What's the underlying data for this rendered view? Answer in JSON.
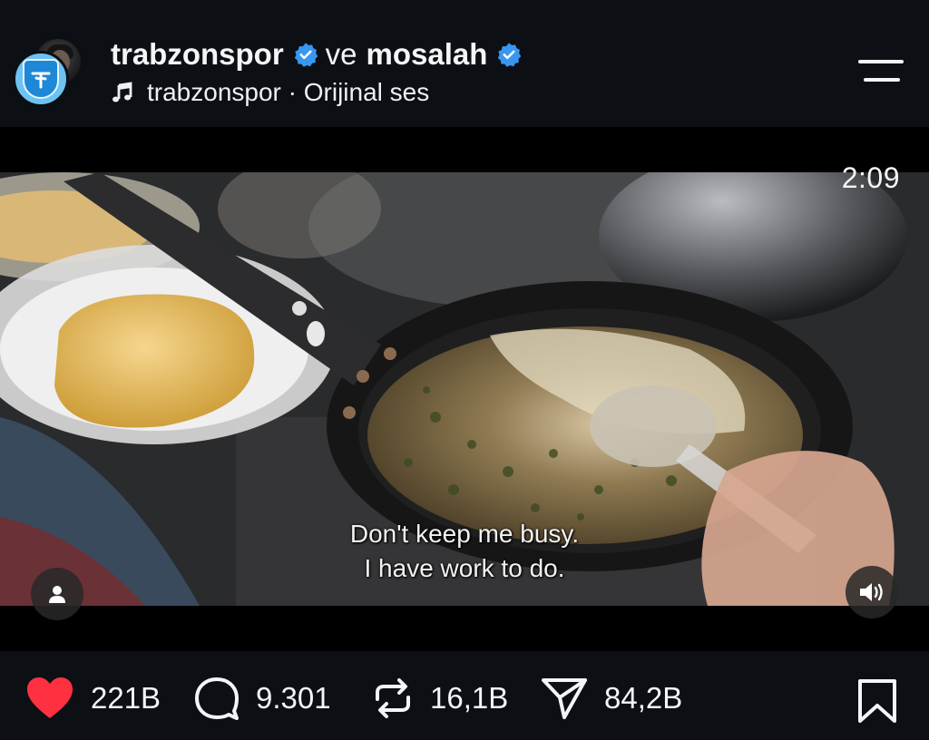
{
  "post": {
    "author_primary": "trabzonspor",
    "connector": "ve",
    "author_secondary": "mosalah",
    "audio_label": "trabzonspor · Orijinal ses"
  },
  "video": {
    "timer": "2:09",
    "subtitle_line1": "Don't keep me busy.",
    "subtitle_line2": "I have work to do."
  },
  "actions": {
    "likes": "221B",
    "comments": "9.301",
    "reposts": "16,1B",
    "shares": "84,2B"
  },
  "icons": {
    "verified": "verified-badge-icon",
    "audio": "music-note-icon",
    "menu": "menu-icon",
    "like": "heart-icon",
    "comment": "comment-icon",
    "repost": "repost-icon",
    "share": "send-icon",
    "save": "bookmark-icon",
    "profile": "user-icon",
    "sound": "speaker-icon"
  },
  "colors": {
    "background": "#0c0f14",
    "verified": "#3897f0",
    "like": "#ff3040"
  }
}
